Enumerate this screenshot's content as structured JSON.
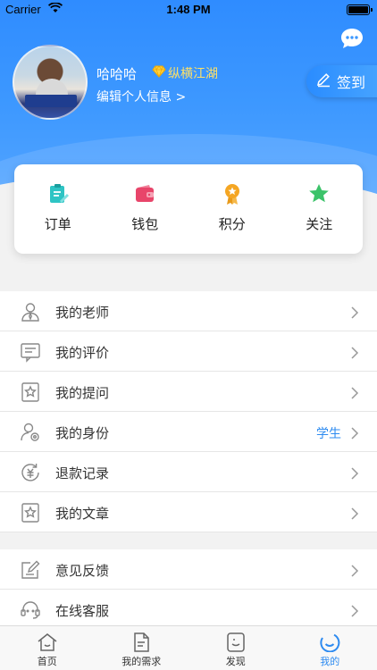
{
  "status_bar": {
    "carrier": "Carrier",
    "time": "1:48 PM"
  },
  "profile": {
    "username": "哈哈哈",
    "vip_level": "纵横江湖",
    "edit_link": "编辑个人信息 >"
  },
  "signin_button": {
    "label": "签到"
  },
  "quick_actions": [
    {
      "label": "订单",
      "icon": "order-icon",
      "color": "#2ec4c4"
    },
    {
      "label": "钱包",
      "icon": "wallet-icon",
      "color": "#e8456a"
    },
    {
      "label": "积分",
      "icon": "points-medal-icon",
      "color": "#f5a623"
    },
    {
      "label": "关注",
      "icon": "star-icon",
      "color": "#3cc36a"
    }
  ],
  "menu_group_1": [
    {
      "label": "我的老师",
      "icon": "teacher-icon",
      "value": ""
    },
    {
      "label": "我的评价",
      "icon": "review-icon",
      "value": ""
    },
    {
      "label": "我的提问",
      "icon": "question-icon",
      "value": ""
    },
    {
      "label": "我的身份",
      "icon": "identity-icon",
      "value": "学生"
    },
    {
      "label": "退款记录",
      "icon": "refund-icon",
      "value": ""
    },
    {
      "label": "我的文章",
      "icon": "article-icon",
      "value": ""
    }
  ],
  "menu_group_2": [
    {
      "label": "意见反馈",
      "icon": "feedback-icon",
      "value": ""
    },
    {
      "label": "在线客服",
      "icon": "customer-service-icon",
      "value": ""
    }
  ],
  "tabbar": [
    {
      "label": "首页",
      "icon": "home-icon",
      "active": false
    },
    {
      "label": "我的需求",
      "icon": "needs-icon",
      "active": false
    },
    {
      "label": "发现",
      "icon": "discover-icon",
      "active": false
    },
    {
      "label": "我的",
      "icon": "profile-icon",
      "active": true
    }
  ],
  "colors": {
    "primary": "#2e8bf0",
    "vip": "#ffe066",
    "header_top": "#2f8cff"
  }
}
